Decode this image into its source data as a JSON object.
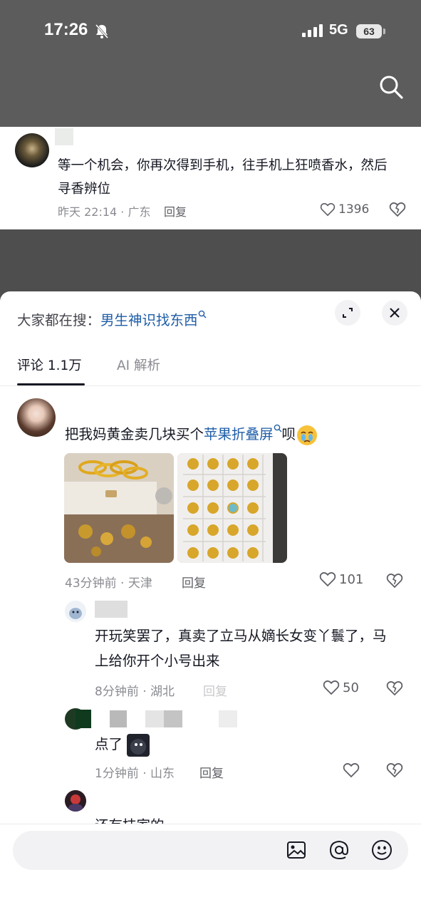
{
  "status_bar": {
    "time": "17:26",
    "network": "5G",
    "battery": "63"
  },
  "top_comment": {
    "text": "等一个机会，你再次得到手机，往手机上狂喷香水，然后寻香辨位",
    "meta": "昨天 22:14 · 广东",
    "reply_label": "回复",
    "likes": "1396"
  },
  "sheet": {
    "search_prefix": "大家都在搜：",
    "search_keyword": "男生神识找东西",
    "tabs": [
      {
        "label": "评论 1.1万",
        "active": true
      },
      {
        "label": "AI 解析",
        "active": false
      }
    ]
  },
  "main_comment": {
    "text_before": "把我妈黄金卖几块买个",
    "keyword": "苹果折叠屏",
    "text_after": "呗",
    "meta": "43分钟前 · 天津",
    "reply_label": "回复",
    "likes": "101"
  },
  "replies": [
    {
      "text": "开玩笑罢了，真卖了立马从嫡长女变丫鬟了，马上给你开个小号出来",
      "meta": "8分钟前 · 湖北",
      "reply_label": "回复",
      "likes": "50"
    },
    {
      "text": "点了",
      "meta": "1分钟前 · 山东",
      "reply_label": "回复"
    },
    {
      "text": "还有技家的"
    }
  ],
  "composer": {
    "placeholder": ""
  },
  "colors": {
    "link": "#1f5ea8",
    "muted": "#8a8b91",
    "text": "#161823"
  }
}
